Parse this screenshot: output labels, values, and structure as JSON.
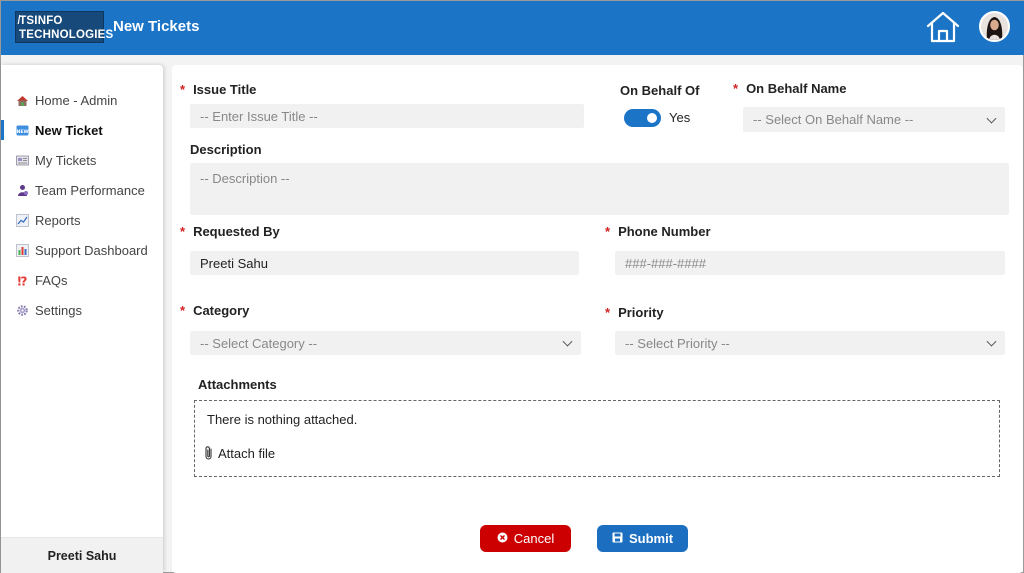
{
  "header": {
    "logo_line1": "̸TSINFO",
    "logo_line2": "TECHNOLOGIES",
    "title": "New Tickets",
    "home_icon": "home-icon",
    "avatar_icon": "user-avatar"
  },
  "sidebar": {
    "items": [
      {
        "label": "Home - Admin",
        "icon": "home-admin-icon"
      },
      {
        "label": "New Ticket",
        "icon": "new-badge-icon",
        "active": true
      },
      {
        "label": "My Tickets",
        "icon": "tickets-icon"
      },
      {
        "label": "Team Performance",
        "icon": "team-icon"
      },
      {
        "label": "Reports",
        "icon": "chart-line-icon"
      },
      {
        "label": "Support Dashboard",
        "icon": "bar-chart-icon"
      },
      {
        "label": "FAQs",
        "icon": "exclamation-question-icon"
      },
      {
        "label": "Settings",
        "icon": "gear-icon"
      }
    ],
    "footer_user": "Preeti Sahu"
  },
  "form": {
    "issue_title": {
      "label": "Issue Title",
      "required": "*",
      "placeholder": "-- Enter Issue Title --"
    },
    "on_behalf_of": {
      "label": "On Behalf Of",
      "toggle_value": "Yes",
      "on": true
    },
    "on_behalf_name": {
      "label": "On Behalf Name",
      "required": "*",
      "placeholder": "-- Select On Behalf Name --"
    },
    "description": {
      "label": "Description",
      "placeholder": "-- Description --"
    },
    "requested_by": {
      "label": "Requested By",
      "required": "*",
      "value": "Preeti Sahu"
    },
    "phone_number": {
      "label": "Phone Number",
      "required": "*",
      "placeholder": "###-###-####"
    },
    "category": {
      "label": "Category",
      "required": "*",
      "placeholder": "-- Select Category --"
    },
    "priority": {
      "label": "Priority",
      "required": "*",
      "placeholder": "-- Select Priority --"
    },
    "attachments": {
      "label": "Attachments",
      "empty_text": "There is nothing attached.",
      "attach_label": "Attach file"
    }
  },
  "actions": {
    "cancel_label": "Cancel",
    "submit_label": "Submit"
  },
  "colors": {
    "header": "#1c74c7",
    "cancel": "#cc0000",
    "submit": "#1c6fc0",
    "required": "#d32020"
  }
}
